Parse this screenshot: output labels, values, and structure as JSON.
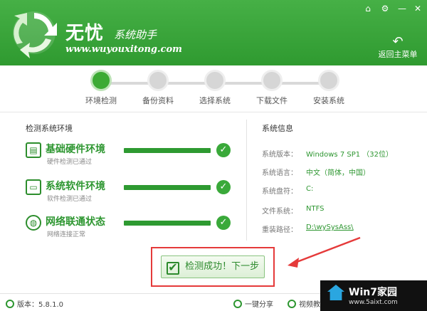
{
  "header": {
    "brand": "无忧",
    "brand_sub": "系统助手",
    "site_url": "www.wuyouxitong.com",
    "back_home": "返回主菜单",
    "controls": {
      "home_glyph": "⌂",
      "settings_glyph": "⚙",
      "minimize_glyph": "—",
      "close_glyph": "✕"
    }
  },
  "steps": [
    {
      "label": "环境检测",
      "active": true
    },
    {
      "label": "备份资料",
      "active": false
    },
    {
      "label": "选择系统",
      "active": false
    },
    {
      "label": "下载文件",
      "active": false
    },
    {
      "label": "安装系统",
      "active": false
    }
  ],
  "detect": {
    "title": "检测系统环境",
    "items": [
      {
        "title": "基础硬件环境",
        "subtitle": "硬件检测已通过",
        "progress": 1.0,
        "status": "passed",
        "icon": "hardware-icon"
      },
      {
        "title": "系统软件环境",
        "subtitle": "软件检测已通过",
        "progress": 1.0,
        "status": "passed",
        "icon": "monitor-icon"
      },
      {
        "title": "网络联通状态",
        "subtitle": "网络连接正常",
        "progress": 1.0,
        "status": "passed",
        "icon": "globe-icon"
      }
    ]
  },
  "sysinfo": {
    "title": "系统信息",
    "rows": [
      {
        "key": "系统版本：",
        "value": "Windows 7 SP1 （32位）"
      },
      {
        "key": "系统语言：",
        "value": "中文（简体，中国）"
      },
      {
        "key": "系统盘符：",
        "value": "C:"
      },
      {
        "key": "文件系统：",
        "value": "NTFS"
      },
      {
        "key": "重装路径：",
        "value": "D:\\wySysAss\\"
      }
    ]
  },
  "next_button": {
    "check_glyph": "✔",
    "label": "检测成功！下一步"
  },
  "footer": {
    "version": "版本：5.8.1.0",
    "share": "一键分享",
    "video": "视频教"
  },
  "watermark": {
    "title": "Win7家园",
    "url": "www.5aixt.com"
  },
  "colors": {
    "brand_green": "#3aa63a",
    "text_green": "#2d9630",
    "highlight_red": "#e53a3a"
  }
}
